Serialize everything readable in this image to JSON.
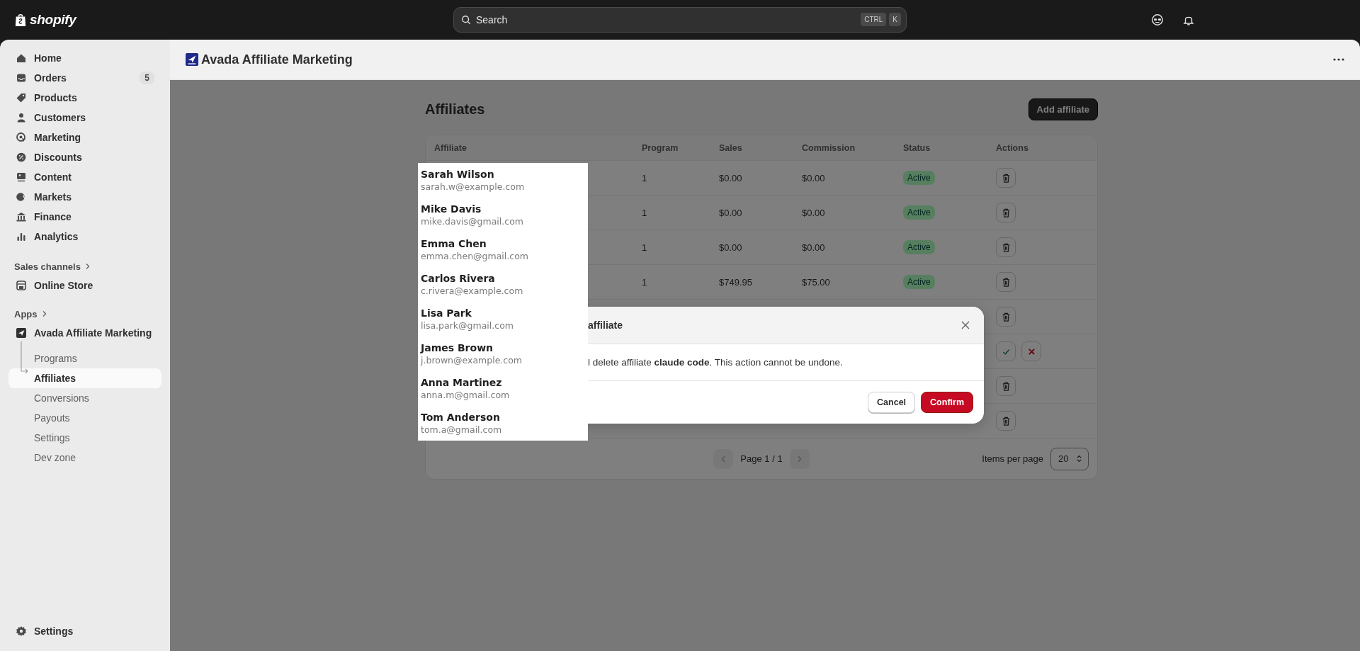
{
  "top_bar": {
    "logo": "shopify",
    "search": {
      "placeholder": "Search",
      "shortcut": [
        "CTRL",
        "K"
      ]
    }
  },
  "sidebar": {
    "items": [
      {
        "label": "Home",
        "selected": false
      },
      {
        "label": "Orders",
        "badge": "5",
        "selected": false
      },
      {
        "label": "Products",
        "selected": false
      },
      {
        "label": "Customers",
        "selected": false
      },
      {
        "label": "Marketing",
        "selected": false
      },
      {
        "label": "Discounts",
        "selected": false
      },
      {
        "label": "Content",
        "selected": false
      },
      {
        "label": "Markets",
        "selected": false
      },
      {
        "label": "Finance",
        "selected": false
      },
      {
        "label": "Analytics",
        "selected": false
      }
    ],
    "sales_channels": {
      "heading": "Sales channels",
      "items": [
        {
          "label": "Online Store",
          "selected": false
        }
      ]
    },
    "apps": {
      "heading": "Apps",
      "app": {
        "label": "Avada Affiliate Marketing",
        "children": [
          {
            "label": "Programs",
            "selected": false
          },
          {
            "label": "Affiliates",
            "selected": true
          },
          {
            "label": "Conversions",
            "selected": false
          },
          {
            "label": "Payouts",
            "selected": false
          },
          {
            "label": "Settings",
            "selected": false
          },
          {
            "label": "Dev zone",
            "selected": false
          }
        ]
      }
    },
    "footer_item": {
      "label": "Settings"
    }
  },
  "app_header": {
    "title": "Avada Affiliate Marketing"
  },
  "page": {
    "title": "Affiliates",
    "primary_action": "Add affiliate"
  },
  "table": {
    "columns": [
      "Affiliate",
      "Program",
      "Sales",
      "Commission",
      "Status",
      "Actions"
    ],
    "rows": [
      {
        "program": "1",
        "sales": "$0.00",
        "commission": "$0.00",
        "status": "Active",
        "kind": "delete"
      },
      {
        "program": "1",
        "sales": "$0.00",
        "commission": "$0.00",
        "status": "Active",
        "kind": "delete"
      },
      {
        "program": "1",
        "sales": "$0.00",
        "commission": "$0.00",
        "status": "Active",
        "kind": "delete"
      },
      {
        "program": "1",
        "sales": "$749.95",
        "commission": "$75.00",
        "status": "Active",
        "kind": "delete"
      },
      {
        "kind": "delete"
      },
      {
        "kind": "review"
      },
      {
        "kind": "delete"
      },
      {
        "kind": "delete"
      }
    ]
  },
  "pagination": {
    "label": "Page 1 / 1",
    "previous_disabled": true,
    "next_disabled": true,
    "items_per_page": {
      "label": "Items per page",
      "value": "20"
    }
  },
  "dropdown": {
    "items": [
      {
        "name": "Sarah Wilson",
        "email": "sarah.w@example.com"
      },
      {
        "name": "Mike Davis",
        "email": "mike.davis@gmail.com"
      },
      {
        "name": "Emma Chen",
        "email": "emma.chen@gmail.com"
      },
      {
        "name": "Carlos Rivera",
        "email": "c.rivera@example.com"
      },
      {
        "name": "Lisa Park",
        "email": "lisa.park@gmail.com"
      },
      {
        "name": "James Brown",
        "email": "j.brown@example.com"
      },
      {
        "name": "Anna Martinez",
        "email": "anna.m@gmail.com"
      },
      {
        "name": "Tom Anderson",
        "email": "tom.a@gmail.com"
      }
    ]
  },
  "modal": {
    "title": "affiliate",
    "message": "l delete affiliate **claude code**. This action cannot be undone.",
    "buttons": [
      {
        "label": "Cancel",
        "kind": "secondary"
      },
      {
        "label": "Confirm",
        "kind": "primary"
      }
    ]
  }
}
